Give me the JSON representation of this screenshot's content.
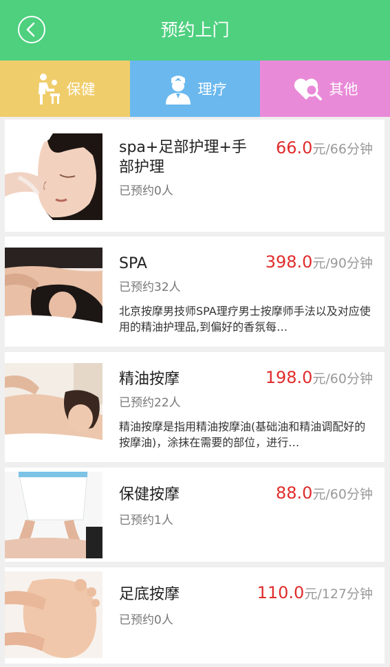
{
  "header": {
    "title": "预约上门"
  },
  "colors": {
    "header_bg": "#4ed07f",
    "tab_health": "#f0cd6b",
    "tab_therapy": "#6ab8ee",
    "tab_other": "#e98ad8",
    "price_red": "#e02c2c"
  },
  "tabs": [
    {
      "label": "保健",
      "icon": "masseur-icon"
    },
    {
      "label": "理疗",
      "icon": "nurse-icon"
    },
    {
      "label": "其他",
      "icon": "heart-search-icon"
    }
  ],
  "services": [
    {
      "name": "spa+足部护理+手部护理",
      "price": "66.0",
      "unit": "元/66分钟",
      "booked": "已预约0人",
      "desc": ""
    },
    {
      "name": "SPA",
      "price": "398.0",
      "unit": "元/90分钟",
      "booked": "已预约32人",
      "desc": "北京按摩男技师SPA理疗男士按摩师手法以及对应使用的精油护理品,到偏好的香氛每…"
    },
    {
      "name": "精油按摩",
      "price": "198.0",
      "unit": "元/60分钟",
      "booked": "已预约22人",
      "desc": "精油按摩是指用精油按摩油(基础油和精油调配好的按摩油)，涂抹在需要的部位，进行…"
    },
    {
      "name": "保健按摩",
      "price": "88.0",
      "unit": "元/60分钟",
      "booked": "已预约1人",
      "desc": ""
    },
    {
      "name": "足底按摩",
      "price": "110.0",
      "unit": "元/127分钟",
      "booked": "已预约0人",
      "desc": ""
    }
  ]
}
